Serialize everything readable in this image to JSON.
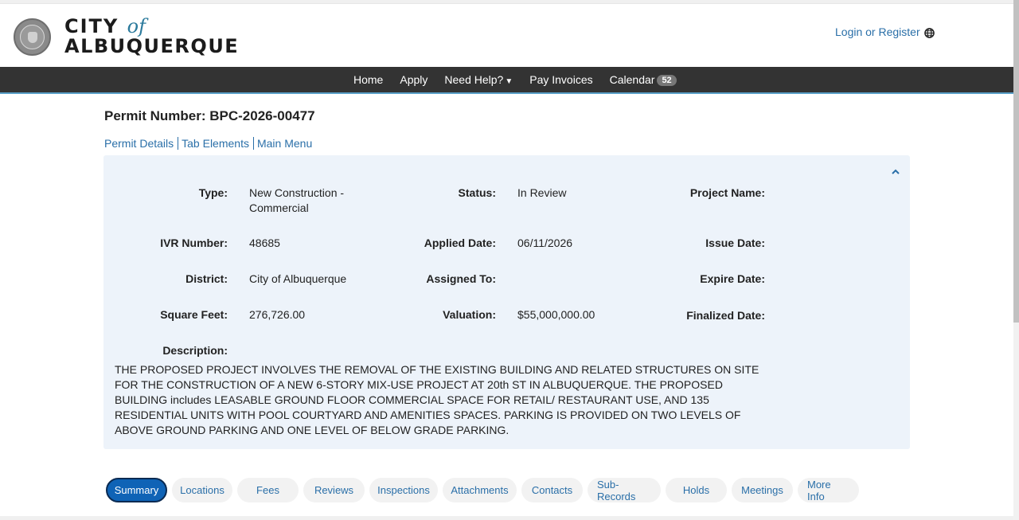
{
  "header": {
    "logo_line1": "CITY",
    "logo_of": "of",
    "logo_line2": "ALBUQUERQUE",
    "login_label": "Login or Register",
    "globe_icon": "globe-icon"
  },
  "nav": {
    "items": [
      "Home",
      "Apply",
      "Need Help?",
      "Pay Invoices",
      "Calendar"
    ],
    "calendar_badge": "52"
  },
  "permit": {
    "title": "Permit Number: BPC-2026-00477",
    "sublinks": [
      "Permit Details",
      "Tab Elements",
      "Main Menu"
    ]
  },
  "details": {
    "type_label": "Type:",
    "type_value": "New Construction - Commercial",
    "status_label": "Status:",
    "status_value": "In Review",
    "project_name_label": "Project Name:",
    "ivr_label": "IVR Number:",
    "ivr_value": "48685",
    "applied_label": "Applied Date:",
    "applied_value": "06/11/2026",
    "issue_label": "Issue Date:",
    "district_label": "District:",
    "district_value": "City of Albuquerque",
    "assigned_label": "Assigned To:",
    "expire_label": "Expire Date:",
    "sqft_label": "Square Feet:",
    "sqft_value": "276,726.00",
    "valuation_label": "Valuation:",
    "valuation_value": "$55,000,000.00",
    "finalized_label": "Finalized Date:",
    "description_label": "Description:",
    "description_value": "THE PROPOSED PROJECT INVOLVES THE REMOVAL OF THE EXISTING BUILDING AND RELATED STRUCTURES ON SITE FOR THE CONSTRUCTION OF A NEW 6-STORY MIX-USE PROJECT AT 20th ST IN ALBUQUERQUE. THE PROPOSED BUILDING includes LEASABLE GROUND FLOOR COMMERCIAL SPACE FOR RETAIL/ RESTAURANT USE, AND 135 RESIDENTIAL UNITS WITH POOL COURTYARD AND AMENITIES SPACES. PARKING IS PROVIDED ON TWO LEVELS OF ABOVE GROUND PARKING AND ONE LEVEL OF BELOW GRADE PARKING."
  },
  "tabs": {
    "items": [
      "Summary",
      "Locations",
      "Fees",
      "Reviews",
      "Inspections",
      "Attachments",
      "Contacts",
      "Sub-Records",
      "Holds",
      "Meetings",
      "More Info"
    ],
    "active": "Summary"
  },
  "colors": {
    "nav_bg": "#333333",
    "link": "#2a6fa8",
    "panel_bg": "#edf3fa",
    "active_tab": "#0f63b6"
  }
}
